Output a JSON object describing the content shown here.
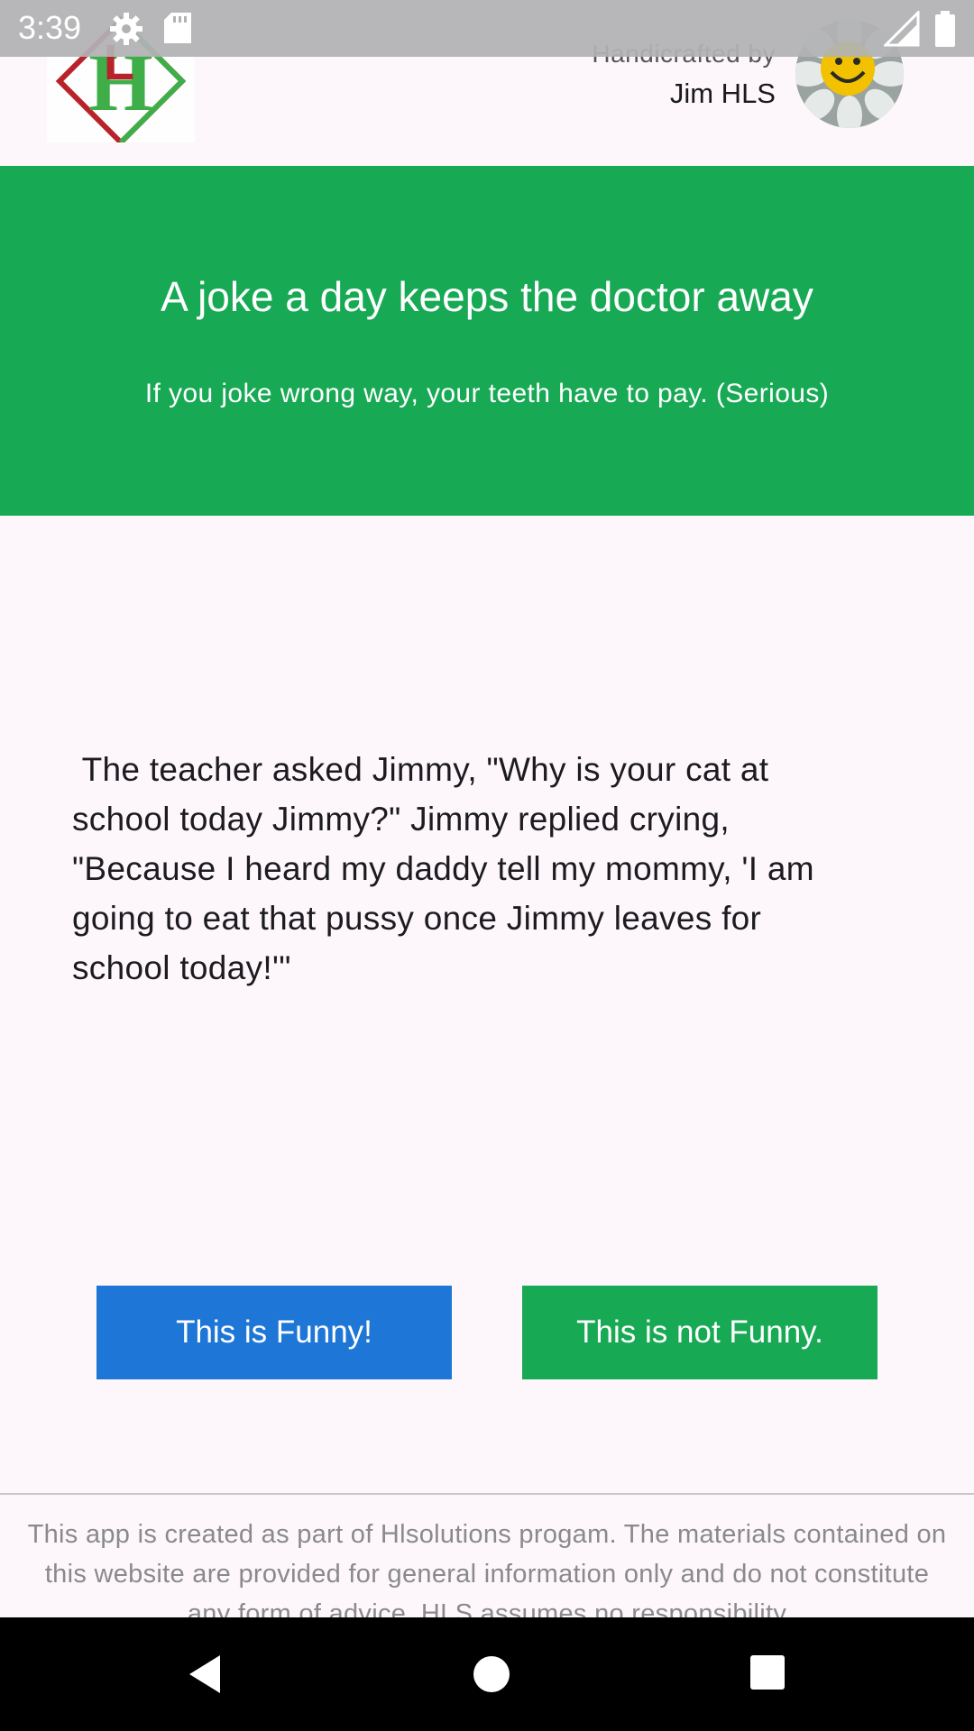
{
  "status_bar": {
    "time": "3:39",
    "icons": [
      "gear-icon",
      "sd-card-icon",
      "signal-icon",
      "battery-icon"
    ]
  },
  "header": {
    "logo_icon": "hls-logo-icon",
    "credit_line": "Handicrafted by",
    "author_name": "Jim HLS",
    "avatar_icon": "smiley-flower-avatar"
  },
  "banner": {
    "title": "A joke a day keeps the doctor away",
    "subtitle": "If you joke wrong way, your teeth have to pay. (Serious)"
  },
  "joke": {
    "text": " The teacher asked Jimmy, \"Why is your cat at school today Jimmy?\" Jimmy replied crying, \"Because I heard my daddy tell my mommy, 'I am going to eat that pussy once Jimmy leaves for school today!'\""
  },
  "actions": {
    "funny_label": "This is Funny!",
    "not_funny_label": "This is not Funny."
  },
  "footer": {
    "disclaimer": "This app is created as part of Hlsolutions progam. The materials contained on this website are provided for general information only and do not constitute any form of advice. HLS assumes no responsibility"
  },
  "nav_bar": {
    "icons": [
      "back-icon",
      "home-icon",
      "recents-icon"
    ]
  },
  "colors": {
    "banner_green": "#18a955",
    "funny_blue": "#1e76d6",
    "not_funny_green": "#18a955",
    "background": "#fdf7fb"
  }
}
